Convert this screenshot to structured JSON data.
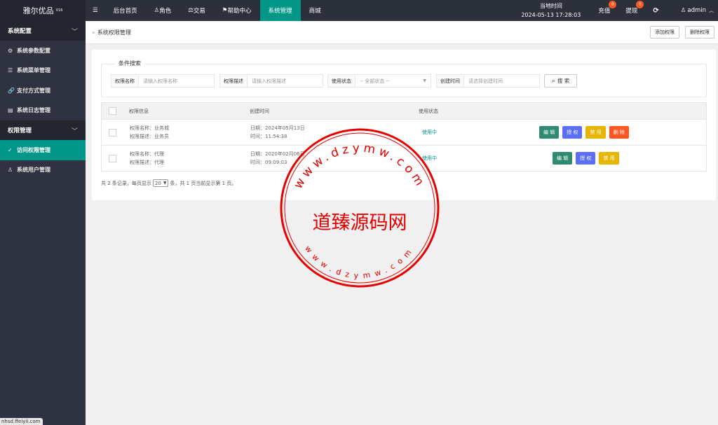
{
  "app": {
    "name": "雅尔优品",
    "version": "V16"
  },
  "sidebar": {
    "groups": [
      {
        "label": "系统配置",
        "items": [
          {
            "label": "系统参数配置",
            "icon": "gear-icon",
            "glyph": "⚙"
          },
          {
            "label": "系统菜单管理",
            "icon": "menu-icon",
            "glyph": "☰"
          },
          {
            "label": "支付方式管理",
            "icon": "link-icon",
            "glyph": "🔗"
          },
          {
            "label": "系统日志管理",
            "icon": "log-icon",
            "glyph": "▤"
          }
        ]
      },
      {
        "label": "权限管理",
        "items": [
          {
            "label": "访问权限管理",
            "icon": "check-circle-icon",
            "glyph": "✓",
            "active": true
          },
          {
            "label": "系统用户管理",
            "icon": "user-icon",
            "glyph": "♙"
          }
        ]
      }
    ],
    "url_hint": "nhsd.ffeiyii.com"
  },
  "topnav": {
    "menu_icon": "☰",
    "items": [
      {
        "label": "后台首页"
      },
      {
        "label": "角色",
        "glyph": "♙"
      },
      {
        "label": "交易",
        "glyph": "⚖"
      },
      {
        "label": "帮助中心",
        "glyph": "⚑"
      },
      {
        "label": "系统管理",
        "active": true
      },
      {
        "label": "商城"
      }
    ],
    "clock_label": "当地时间",
    "clock_value": "2024-05-13 17:28:03",
    "recharge": {
      "label": "充值",
      "badge": "0"
    },
    "withdraw": {
      "label": "提现",
      "badge": "0"
    },
    "refresh_glyph": "⟳",
    "user": "admin"
  },
  "breadcrumb": {
    "prefix": "»",
    "title": "系统权限管理"
  },
  "actions": {
    "add": "添加权限",
    "delete": "删除权限"
  },
  "search": {
    "legend": "条件搜索",
    "fields": [
      {
        "label": "权限名称",
        "placeholder": "请输入权限名称"
      },
      {
        "label": "权限描述",
        "placeholder": "请输入权限描述"
      },
      {
        "label": "使用状态",
        "placeholder": "-- 全部状态 --"
      },
      {
        "label": "创建时间",
        "placeholder": "请选择创建时间"
      }
    ],
    "button": "搜 索"
  },
  "table": {
    "headers": [
      "权限信息",
      "创建时间",
      "使用状态"
    ],
    "rows": [
      {
        "name": "权限名称：业务城",
        "desc": "权限描述：业务员",
        "date": "日期：2024年05月13日",
        "time": "时间：11:54:38",
        "status": "使用中",
        "ops": [
          "编 辑",
          "授 权",
          "禁 用",
          "删 除"
        ]
      },
      {
        "name": "权限名称：代理",
        "desc": "权限描述：代理",
        "date": "日期：2020年02月06日",
        "time": "时间：09:09:03",
        "status": "使用中",
        "ops": [
          "编 辑",
          "授 权",
          "禁 用"
        ]
      }
    ]
  },
  "pager": {
    "before": "共 2 条记录，每页显示",
    "size": "20",
    "after": "条，共 1 页当前显示第 1 页。"
  },
  "watermark": {
    "center": "道臻源码网",
    "top_ring": "www.dzymw.com",
    "bottom_ring": "www.dzymw.com"
  },
  "colors": {
    "accent": "#009688",
    "blue": "#5b6ef5",
    "yellow": "#e8b500",
    "red": "#ff5722",
    "stamp": "#e60000"
  }
}
